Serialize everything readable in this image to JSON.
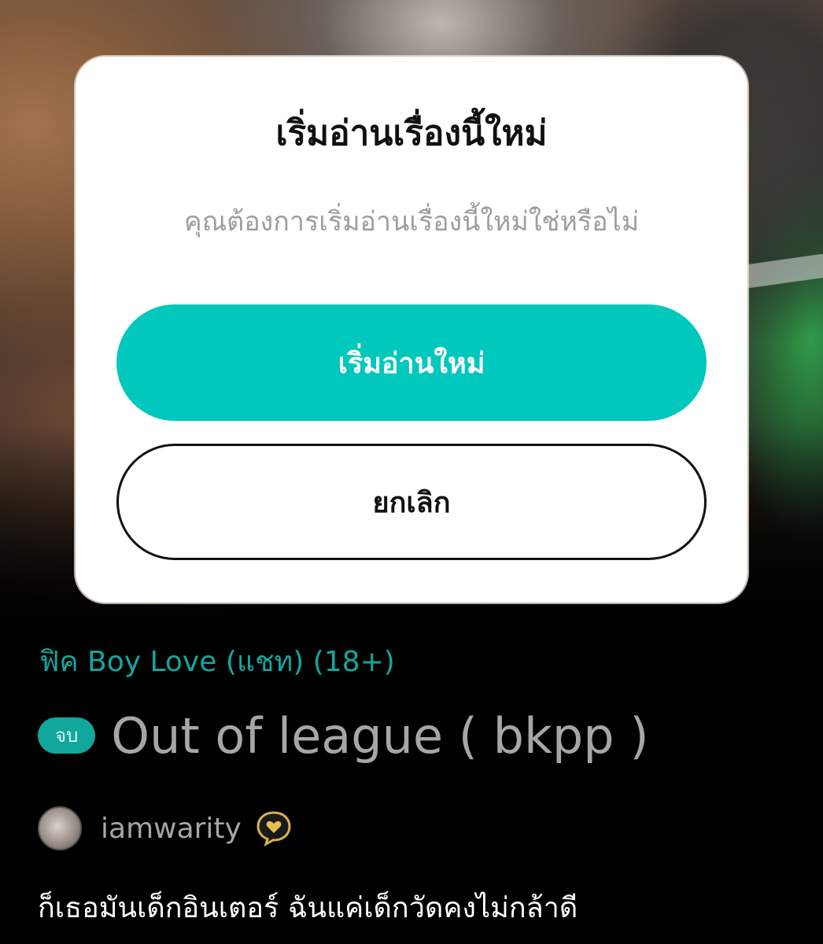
{
  "dialog": {
    "title": "เริ่มอ่านเรื่องนี้ใหม่",
    "message": "คุณต้องการเริ่มอ่านเรื่องนี้ใหม่ใช่หรือไม่",
    "confirm_label": "เริ่มอ่านใหม่",
    "cancel_label": "ยกเลิก"
  },
  "story": {
    "category": "ฟิค Boy Love (แชท) (18+)",
    "status_badge": "จบ",
    "title": "Out of league ( bkpp )",
    "author": "iamwarity",
    "author_badge_icon": "heart-badge-icon",
    "description": "ก็เธอมันเด็กอินเตอร์ ฉันแค่เด็กวัดคงไม่กล้าดี"
  },
  "colors": {
    "accent": "#00c8bd",
    "category": "#12a79d",
    "badge_gold": "#d9b24a"
  }
}
